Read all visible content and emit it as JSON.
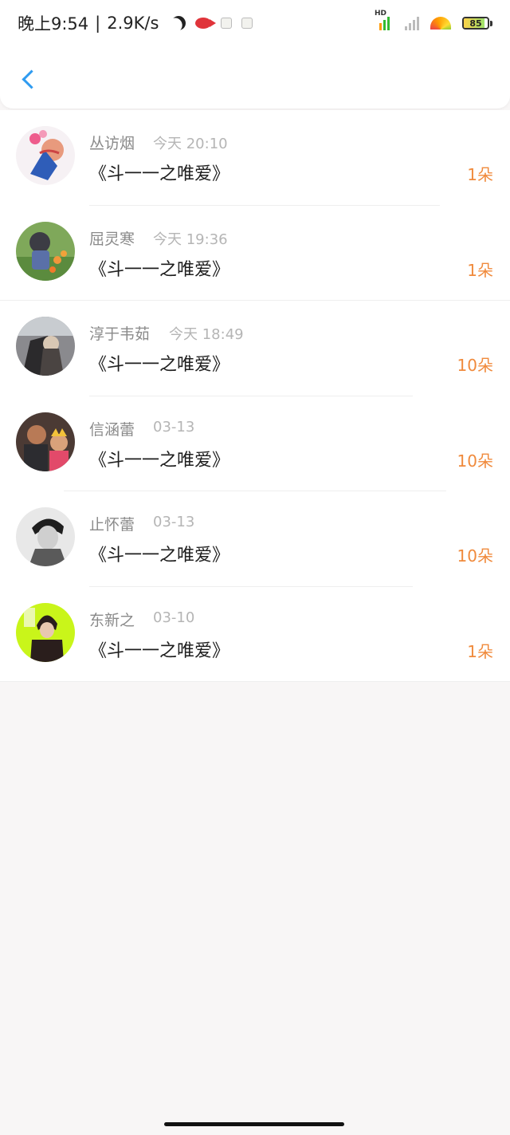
{
  "status_bar": {
    "time": "晚上9:54",
    "separator": "|",
    "speed": "2.9K/s",
    "hd_label": "HD",
    "battery": "85",
    "battery_level": 0.85,
    "icons": [
      "moon-icon",
      "fish-icon",
      "pet-icon",
      "pet-icon",
      "signal-hd-icon",
      "signal-icon",
      "wifi-rainbow-icon",
      "battery-icon"
    ]
  },
  "nav": {
    "back_icon": "chevron-left-icon",
    "accent_color": "#2f9bf0"
  },
  "colors": {
    "amount": "#f08a3c",
    "name": "#8a8a8a",
    "time": "#b5b5b5",
    "background": "#f8f6f6"
  },
  "records": [
    {
      "name": "丛访烟",
      "time": "今天 20:10",
      "title": "《斗一一之唯爱》",
      "amount": "1朵"
    },
    {
      "name": "屈灵寒",
      "time": "今天 19:36",
      "title": "《斗一一之唯爱》",
      "amount": "1朵"
    },
    {
      "name": "淳于韦茹",
      "time": "今天 18:49",
      "title": "《斗一一之唯爱》",
      "amount": "10朵"
    },
    {
      "name": "信涵蕾",
      "time": "03-13",
      "title": "《斗一一之唯爱》",
      "amount": "10朵"
    },
    {
      "name": "止怀蕾",
      "time": "03-13",
      "title": "《斗一一之唯爱》",
      "amount": "10朵"
    },
    {
      "name": "东新之",
      "time": "03-10",
      "title": "《斗一一之唯爱》",
      "amount": "1朵"
    }
  ]
}
